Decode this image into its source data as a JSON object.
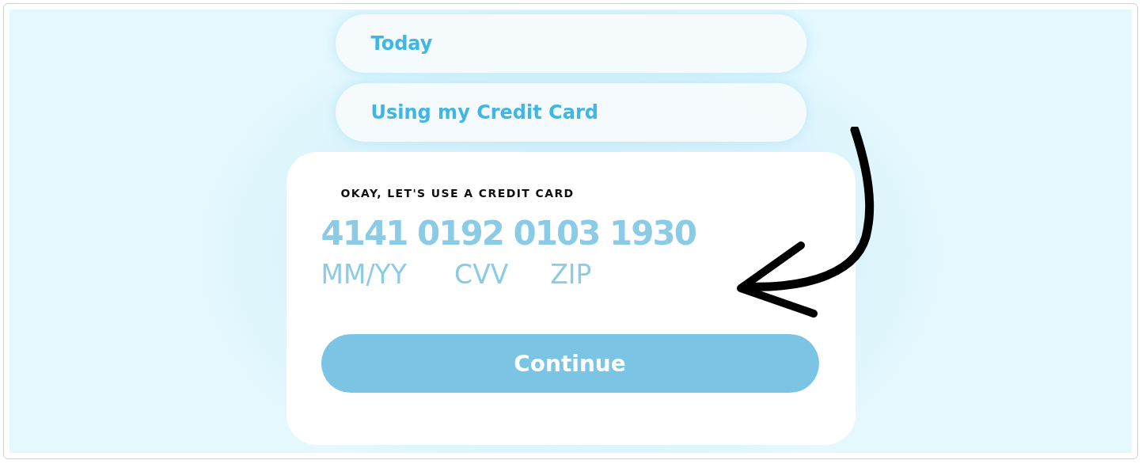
{
  "selections": [
    {
      "label": "Today"
    },
    {
      "label": "Using my Credit Card"
    }
  ],
  "card_form": {
    "title": "OKAY, LET'S USE A CREDIT CARD",
    "card_number": {
      "placeholder": "4141 0192 0103 1930"
    },
    "fields": [
      {
        "placeholder": "MM/YY"
      },
      {
        "placeholder": "CVV"
      },
      {
        "placeholder": "ZIP"
      }
    ],
    "button": {
      "label": "Continue",
      "disabled": true
    }
  }
}
